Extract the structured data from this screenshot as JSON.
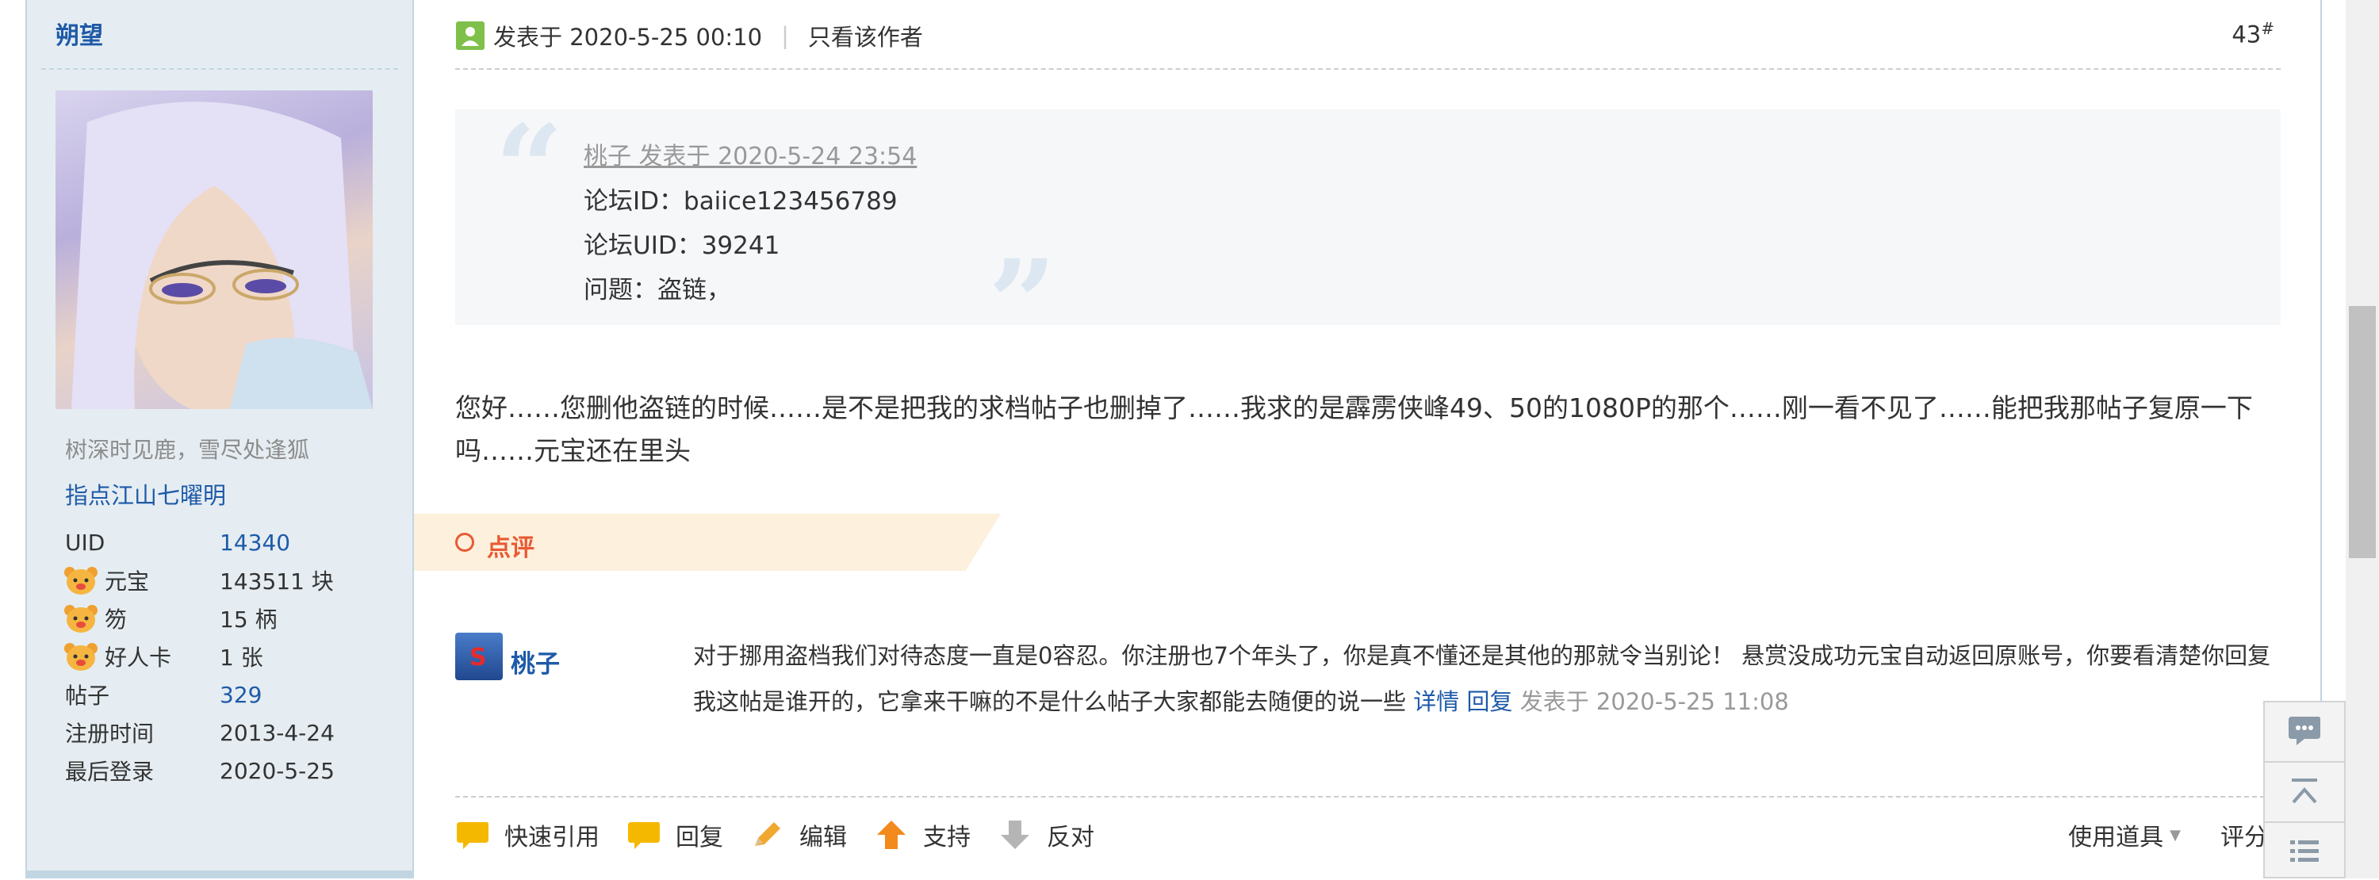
{
  "sidebar": {
    "username": "朔望",
    "motto": "树深时见鹿，雪尽处逢狐",
    "title": "指点江山七曜明",
    "stats": [
      {
        "key": "UID",
        "value": "14340",
        "icon": null,
        "link": true
      },
      {
        "key": "元宝",
        "value": "143511 块",
        "icon": "bear-coin-icon",
        "link": false
      },
      {
        "key": "笏",
        "value": "15 柄",
        "icon": "bear-coin-icon",
        "link": false
      },
      {
        "key": "好人卡",
        "value": "1 张",
        "icon": "bear-coin-icon",
        "link": false
      },
      {
        "key": "帖子",
        "value": "329",
        "icon": null,
        "link": true
      },
      {
        "key": "注册时间",
        "value": "2013-4-24",
        "icon": null,
        "link": false
      },
      {
        "key": "最后登录",
        "value": "2020-5-25",
        "icon": null,
        "link": false
      }
    ]
  },
  "post": {
    "posted_label": "发表于 2020-5-25 00:10",
    "separator": "|",
    "only_author": "只看该作者",
    "floor_number": "43",
    "floor_mark": "#",
    "quote": {
      "author_line": "桃子 发表于 2020-5-24 23:54",
      "lines": [
        "论坛ID：baiice123456789",
        "论坛UID：39241",
        "问题：盗链，"
      ]
    },
    "body": "您好……您删他盗链的时候……是不是把我的求档帖子也删掉了……我求的是霹雳侠峰49、50的1080P的那个……刚一看不见了……能把我那帖子复原一下吗……元宝还在里头"
  },
  "comments": {
    "header_label": "点评",
    "items": [
      {
        "user": "桃子",
        "text": "对于挪用盗档我们对待态度一直是0容忍。你注册也7个年头了，你是真不懂还是其他的那就令当别论！ 悬赏没成功元宝自动返回原账号，你要看清楚你回复我这帖是谁开的，它拿来干嘛的不是什么帖子大家都能去随便的说一些",
        "detail_link": "详情",
        "reply_link": "回复",
        "time": "发表于 2020-5-25 11:08"
      }
    ]
  },
  "actions": {
    "quick_quote": "快速引用",
    "reply": "回复",
    "edit": "编辑",
    "support": "支持",
    "oppose": "反对",
    "use_tools": "使用道具",
    "rate": "评分"
  },
  "colors": {
    "link_blue": "#1e5aa8",
    "sidebar_bg": "#e5edf2",
    "comment_accent": "#e85a33"
  }
}
